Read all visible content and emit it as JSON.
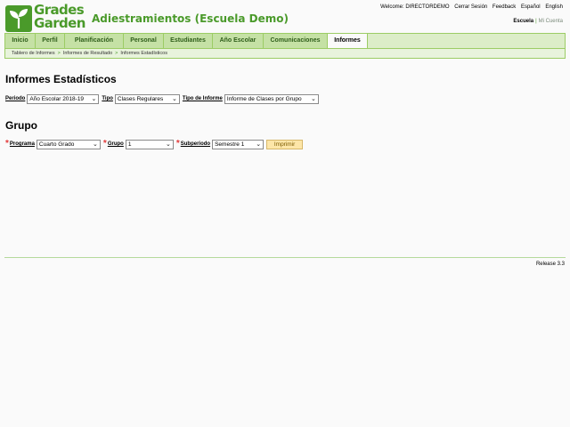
{
  "header": {
    "logo_text_1": "Grades",
    "logo_text_2": "Garden",
    "app_title": "Adiestramientos (Escuela Demo)",
    "welcome": "Welcome: DIRECTORDEMO",
    "logout": "Cerrar Sesión",
    "feedback": "Feedback",
    "lang_es": "Español",
    "lang_en": "English",
    "scope_school": "Escuela",
    "scope_account": "Mi Cuenta"
  },
  "menu": {
    "items": [
      {
        "label": "Inicio"
      },
      {
        "label": "Perfil"
      },
      {
        "label": "Planificación"
      },
      {
        "label": "Personal"
      },
      {
        "label": "Estudiantes"
      },
      {
        "label": "Año Escolar"
      },
      {
        "label": "Comunicaciones"
      },
      {
        "label": "Informes"
      }
    ],
    "active": "Informes"
  },
  "breadcrumb": {
    "items": [
      "Tablero de Informes",
      "Informes de Resultado",
      "Informes Estadísticos"
    ],
    "separator": ">"
  },
  "stats": {
    "title": "Informes Estadísticos",
    "period_label": "Periodo",
    "period_value": "Año Escolar 2018-19",
    "type_label": "Tipo",
    "type_value": "Clases Regulares",
    "report_type_label": "Tipo de Informe",
    "report_type_value": "Informe de Clases por Grupo"
  },
  "group": {
    "title": "Grupo",
    "program_label": "Programa",
    "program_value": "Cuarto Grado",
    "group_label": "Grupo",
    "group_value": "1",
    "subperiod_label": "Subperiodo",
    "subperiod_value": "Semestre 1",
    "print_label": "Imprimir",
    "required_mark": "*"
  },
  "footer": {
    "release": "Release 3.3"
  },
  "colors": {
    "brand_green": "#4a9a2a",
    "menu_bg": "#c5e1a5",
    "required_red": "#e23b3b",
    "print_button_bg": "#fde6a8"
  },
  "icons": {
    "dropdown": "chevron-down-icon",
    "logo": "sprout-icon"
  }
}
